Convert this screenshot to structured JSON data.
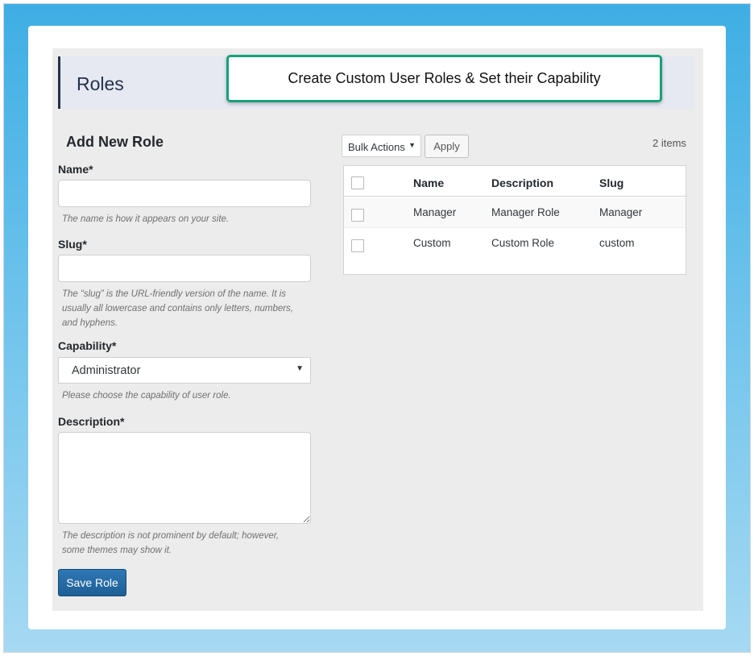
{
  "page": {
    "title": "Roles",
    "callout": "Create Custom User Roles & Set their Capability"
  },
  "form": {
    "title": "Add New Role",
    "name_label": "Name*",
    "name_value": "",
    "name_help": "The name is how it appears on your site.",
    "slug_label": "Slug*",
    "slug_value": "",
    "slug_help": "The “slug” is the URL-friendly version of the name. It is usually all lowercase and contains only letters, numbers, and hyphens.",
    "capability_label": "Capability*",
    "capability_value": "Administrator",
    "capability_help": "Please choose the capability of user role.",
    "description_label": "Description*",
    "description_value": "",
    "description_help": "The description is not prominent by default; however, some themes may show it.",
    "save_label": "Save Role"
  },
  "list": {
    "bulk_actions_label": "Bulk Actions",
    "apply_label": "Apply",
    "items_count": "2 items",
    "columns": [
      "Name",
      "Description",
      "Slug"
    ],
    "rows": [
      {
        "name": "Manager",
        "description": "Manager Role",
        "slug": "Manager"
      },
      {
        "name": "Custom",
        "description": "Custom Role",
        "slug": "custom"
      }
    ]
  },
  "icons": {
    "select_arrow": "chevron-down-icon",
    "checkbox": "checkbox-icon"
  },
  "colors": {
    "accent": "#2271b1",
    "callout_border": "#17a07a",
    "header_border": "#23324a",
    "frame_gradient_top": "#3faee4",
    "frame_gradient_bottom": "#a6d9f2"
  }
}
